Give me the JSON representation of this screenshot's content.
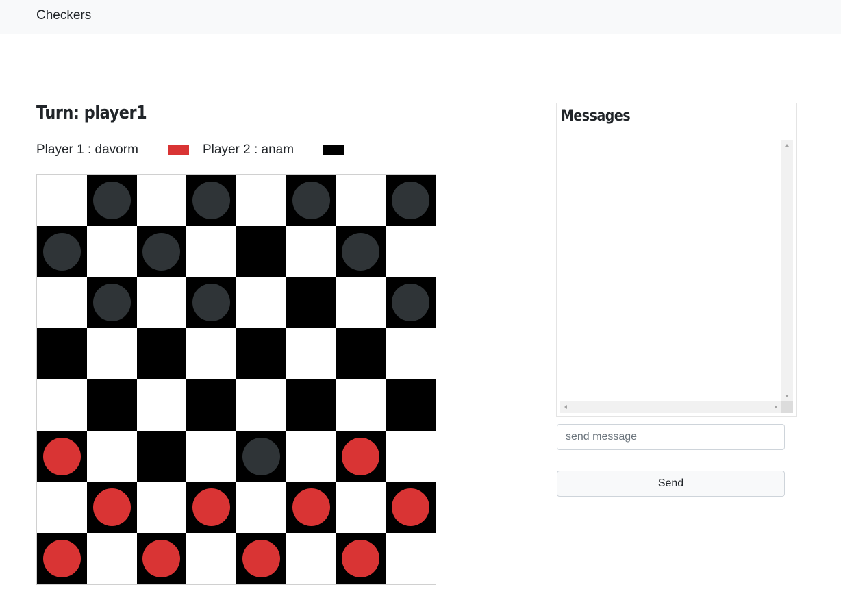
{
  "navbar": {
    "brand": "Checkers"
  },
  "game": {
    "turn_label": "Turn: player1",
    "player1": {
      "label": "Player 1 : davorm",
      "color": "#d93434"
    },
    "player2": {
      "label": "Player 2 : anam",
      "color": "#000000"
    }
  },
  "board": {
    "size": 8,
    "dark_square_color": "#000000",
    "light_square_color": "#ffffff",
    "piece_colors": {
      "b": "#2f3437",
      "r": "#d93434"
    },
    "rows": [
      "-b-b-b-b",
      "b-b---b-",
      "-b-b---b",
      "--------",
      "--------",
      "r---b-r-",
      "-r-r-r-r",
      "r-r-r-r-"
    ]
  },
  "chat": {
    "title": "Messages",
    "messages": [],
    "input_placeholder": "send message",
    "input_value": "",
    "send_label": "Send"
  }
}
